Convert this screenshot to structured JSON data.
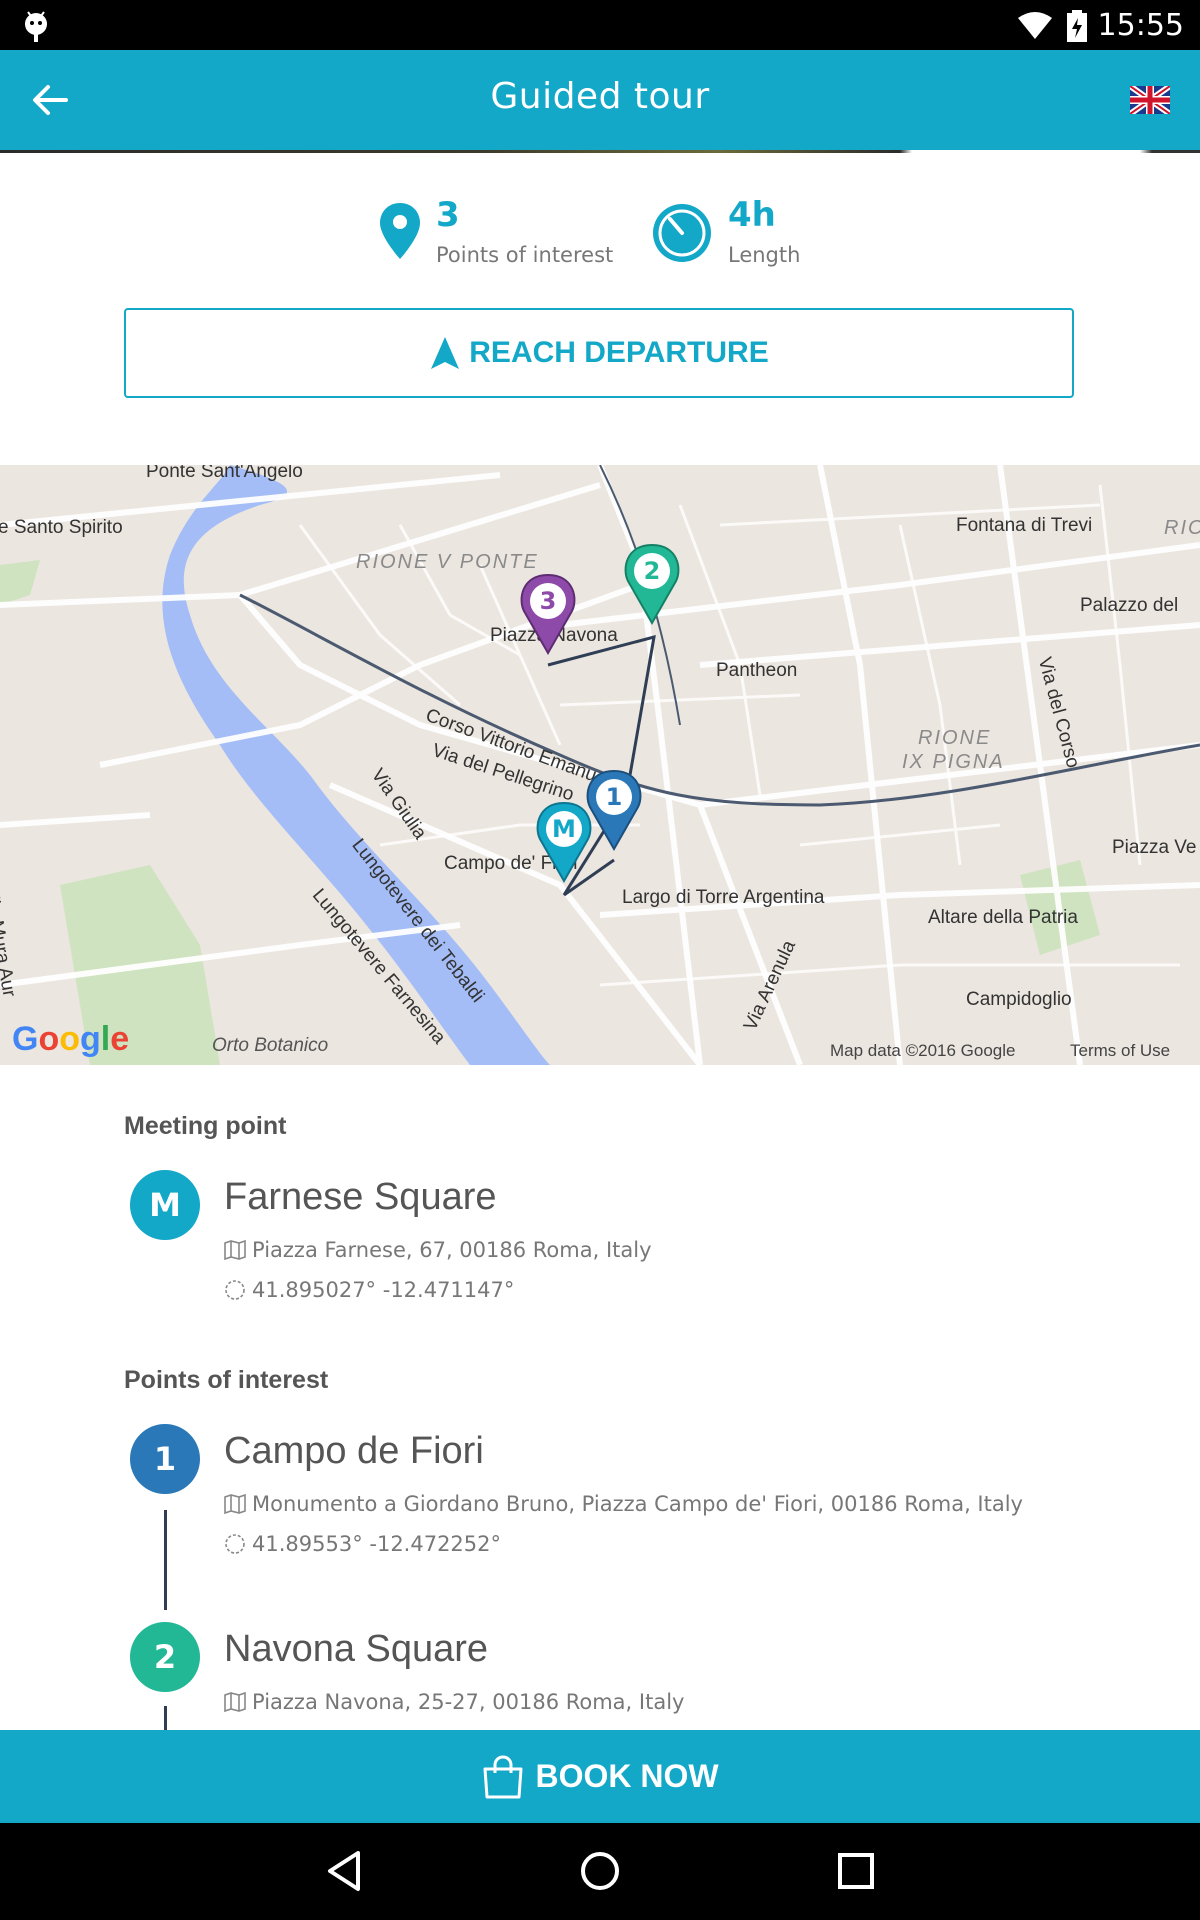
{
  "status_bar": {
    "time": "15:55"
  },
  "app_bar": {
    "title": "Guided tour"
  },
  "stats": {
    "points_value": "3",
    "points_label": "Points of interest",
    "length_value": "4h",
    "length_label": "Length"
  },
  "reach_departure": {
    "label": "REACH DEPARTURE"
  },
  "map": {
    "labels": {
      "ponte": "Ponte Sant'Angelo",
      "santo_spirito": "e Santo Spirito",
      "rione_ponte": "RIONE V PONTE",
      "fontana": "Fontana di Trevi",
      "palazzo": "Palazzo del",
      "piazza_navona": "Piazza Navona",
      "pantheon": "Pantheon",
      "corso": "Corso Vittorio Emanuele II",
      "pellegrino": "Via del Pellegrino",
      "giulia": "Via Giulia",
      "rione_pigna_1": "RIONE",
      "rione_pigna_2": "IX PIGNA",
      "via_corso": "Via del Corso",
      "piazza_ve": "Piazza Ve",
      "campo": "Campo de' Fiori",
      "largo": "Largo di Torre Argentina",
      "altare": "Altare della Patria",
      "lungotevere_tebaldi": "Lungotevere dei Tebaldi",
      "lungotevere_farnesina": "Lungotevere Farnesina",
      "arenula": "Via Arenula",
      "campidoglio": "Campidoglio",
      "orto": "Orto Botanico",
      "aurelia": "lle Mura Aur",
      "rio": "RIO",
      "map_data": "Map data ©2016 Google",
      "terms": "Terms of Use",
      "google": "Google"
    },
    "markers": [
      {
        "label": "M",
        "color": "#13a7c8"
      },
      {
        "label": "1",
        "color": "#2a78b8"
      },
      {
        "label": "2",
        "color": "#22b896"
      },
      {
        "label": "3",
        "color": "#8e4aa8"
      }
    ]
  },
  "meeting": {
    "section_title": "Meeting point",
    "badge": "M",
    "badge_color": "#13a7c8",
    "name": "Farnese Square",
    "address": "Piazza Farnese, 67, 00186 Roma, Italy",
    "coords": "41.895027° -12.471147°"
  },
  "points": {
    "section_title": "Points of interest",
    "items": [
      {
        "badge": "1",
        "badge_color": "#2a78b8",
        "name": "Campo de Fiori",
        "address": "Monumento a Giordano Bruno, Piazza Campo de' Fiori, 00186 Roma, Italy",
        "coords": "41.89553° -12.472252°"
      },
      {
        "badge": "2",
        "badge_color": "#22b896",
        "name": "Navona Square",
        "address": "Piazza Navona, 25-27, 00186 Roma, Italy"
      }
    ]
  },
  "book_now": {
    "label": "BOOK NOW"
  },
  "colors": {
    "primary": "#13a7c8",
    "route": "#2f3e55"
  }
}
